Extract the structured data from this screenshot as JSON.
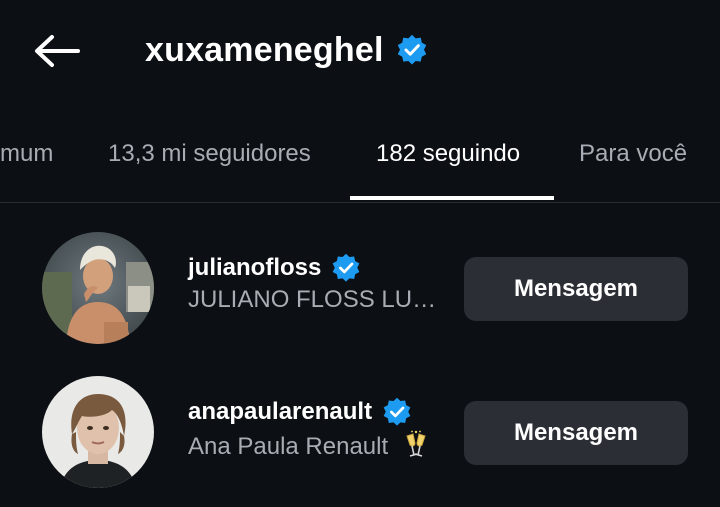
{
  "header": {
    "title": "xuxameneghel",
    "back_icon": "arrow-left-icon",
    "verified_icon": "verified-badge-icon"
  },
  "tabs": [
    {
      "label": "mum"
    },
    {
      "label": "13,3 mi seguidores"
    },
    {
      "label": "182 seguindo",
      "active": true
    },
    {
      "label": "Para você"
    }
  ],
  "list": [
    {
      "username": "julianofloss",
      "full_name": "JULIANO FLOSS LU…",
      "verified": true,
      "button_label": "Mensagem"
    },
    {
      "username": "anapaularenault",
      "full_name": "Ana Paula Renault",
      "verified": true,
      "emoji_icon": "champagne-toast-icon",
      "button_label": "Mensagem"
    }
  ],
  "colors": {
    "background": "#0c0f14",
    "verified_blue": "#1d9bf0",
    "button_bg": "#2b2e35",
    "muted_text": "#a8acb3"
  }
}
